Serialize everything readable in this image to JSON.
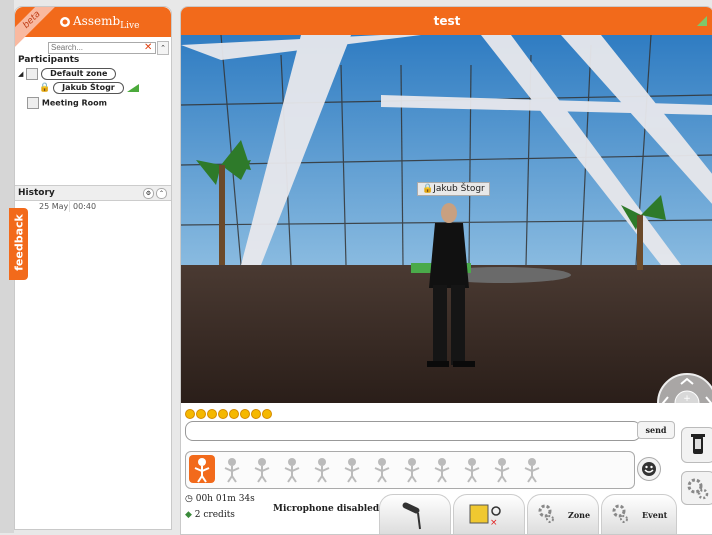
{
  "app": {
    "brand": "Assemb",
    "brand_sub": "Live",
    "beta": "beta",
    "accent": "#f26a1b"
  },
  "sidebar": {
    "search_placeholder": "Search...",
    "participants_label": "Participants",
    "tree": [
      {
        "label": "Default zone",
        "type": "zone"
      },
      {
        "label": "Jakub Štogr",
        "type": "user"
      },
      {
        "label": "Meeting Room",
        "type": "room"
      }
    ],
    "history": {
      "label": "History",
      "date": "25 May",
      "time": "00:40"
    },
    "feedback": "feedback"
  },
  "main": {
    "title": "test",
    "avatar_name": "Jakub Štogr",
    "chat_placeholder": "",
    "send_label": "send",
    "timer": "00h 01m 34s",
    "credits": "2 credits",
    "mic_status": "Microphone disabled",
    "toolbar": [
      {
        "label": "",
        "icon": "microphone-icon"
      },
      {
        "label": "",
        "icon": "document-share-icon"
      },
      {
        "label": "Zone",
        "icon": "gears-icon"
      },
      {
        "label": "Event",
        "icon": "gears-icon"
      }
    ],
    "emoticon_count": 8,
    "gesture_count": 12
  }
}
